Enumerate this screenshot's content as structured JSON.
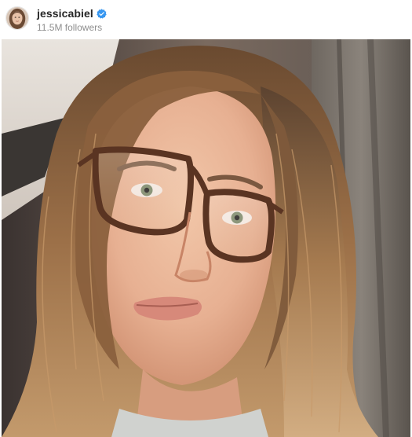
{
  "post": {
    "username": "jessicabiel",
    "followers": "11.5M followers"
  },
  "icons": {
    "verified": "verified-badge-icon",
    "avatar": "profile-avatar"
  },
  "colors": {
    "verified_blue": "#3897f0",
    "username_text": "#262626",
    "secondary_text": "#8e8e8e"
  }
}
